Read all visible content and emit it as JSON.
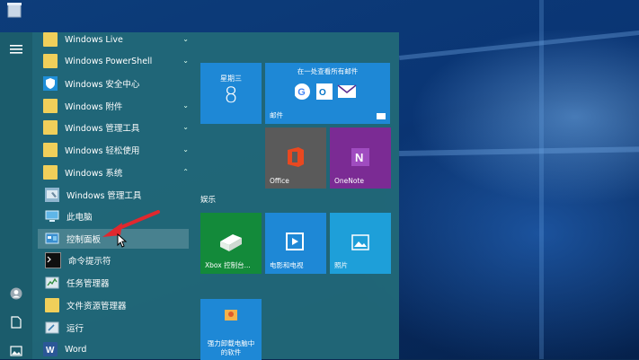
{
  "apps": [
    {
      "label": "Windows Live",
      "icon": "folder-icon",
      "chevron": "⌄"
    },
    {
      "label": "Windows PowerShell",
      "icon": "folder-icon",
      "chevron": "⌄"
    },
    {
      "label": "Windows 安全中心",
      "icon": "shield-icon",
      "chevron": ""
    },
    {
      "label": "Windows 附件",
      "icon": "folder-icon",
      "chevron": "⌄"
    },
    {
      "label": "Windows 管理工具",
      "icon": "folder-icon",
      "chevron": "⌄"
    },
    {
      "label": "Windows 轻松使用",
      "icon": "folder-icon",
      "chevron": "⌄"
    },
    {
      "label": "Windows 系统",
      "icon": "folder-icon",
      "chevron": "⌃"
    },
    {
      "label": "Windows 管理工具",
      "icon": "admin-tools-icon",
      "chevron": ""
    },
    {
      "label": "此电脑",
      "icon": "computer-icon",
      "chevron": ""
    },
    {
      "label": "控制面板",
      "icon": "control-panel-icon",
      "chevron": ""
    },
    {
      "label": "命令提示符",
      "icon": "cmd-icon",
      "chevron": ""
    },
    {
      "label": "任务管理器",
      "icon": "task-manager-icon",
      "chevron": ""
    },
    {
      "label": "文件资源管理器",
      "icon": "folder-icon",
      "chevron": ""
    },
    {
      "label": "运行",
      "icon": "run-icon",
      "chevron": ""
    },
    {
      "label": "Word",
      "icon": "word-icon",
      "chevron": ""
    }
  ],
  "tiles": {
    "calendar": {
      "weekday": "星期三",
      "day": "8"
    },
    "mail": {
      "header": "在一处查看所有邮件",
      "label": "邮件"
    },
    "office": {
      "label": "Office"
    },
    "onenote": {
      "label": "OneNote"
    },
    "group_entertainment": "娱乐",
    "xbox": {
      "label": "Xbox 控制台..."
    },
    "movies": {
      "label": "电影和电视"
    },
    "photos": {
      "label": "照片"
    },
    "cleaner": {
      "line1": "强力卸载电脑中",
      "line2": "的软件"
    }
  },
  "colors": {
    "tile_blue": "#1e88d6",
    "tile_gray": "#5a5a5a",
    "tile_purple": "#7b2b94",
    "tile_green": "#138a3a",
    "accent_red": "#e0282e"
  }
}
